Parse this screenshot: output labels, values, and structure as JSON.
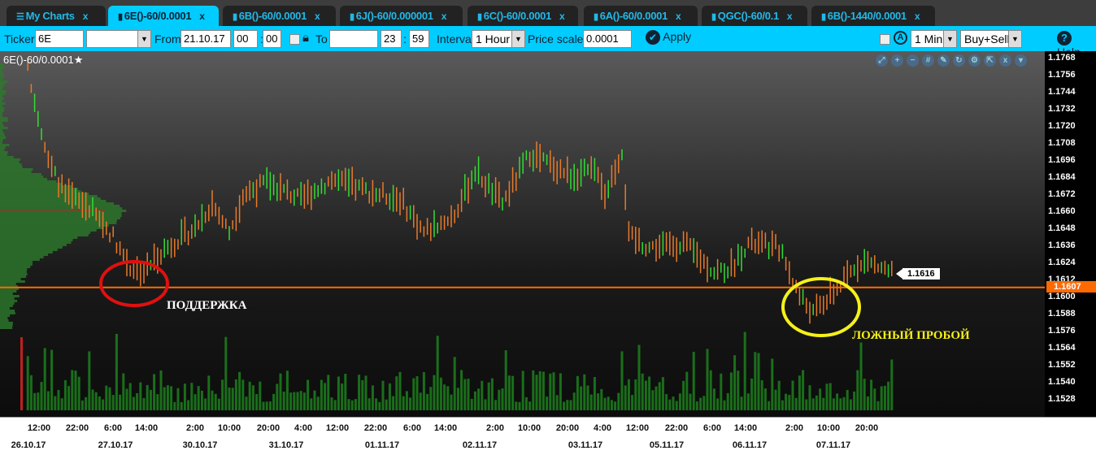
{
  "tabs": [
    {
      "label": "My Charts",
      "icon": "menu-icon",
      "active": false
    },
    {
      "label": "6E()-60/0.0001",
      "icon": "bar-chart-icon",
      "active": true
    },
    {
      "label": "6B()-60/0.0001",
      "icon": "bar-chart-icon",
      "active": false
    },
    {
      "label": "6J()-60/0.000001",
      "icon": "bar-chart-icon",
      "active": false
    },
    {
      "label": "6C()-60/0.0001",
      "icon": "bar-chart-icon",
      "active": false
    },
    {
      "label": "6A()-60/0.0001",
      "icon": "bar-chart-icon",
      "active": false
    },
    {
      "label": "QGC()-60/0.1",
      "icon": "bar-chart-icon",
      "active": false
    },
    {
      "label": "6B()-1440/0.0001",
      "icon": "bar-chart-icon",
      "active": false
    }
  ],
  "close_glyph": "x",
  "toolbar": {
    "ticker_label": "Ticker",
    "ticker": "6E",
    "from_label": "From",
    "from_date": "21.10.17",
    "from_h": "00",
    "from_m": "00",
    "to_label": "To",
    "to_date": "",
    "to_h": "23",
    "to_m": "59",
    "colon": ":",
    "interval_label": "Interval",
    "interval": "1 Hour",
    "price_scale_label": "Price scale",
    "price_scale": "0.0001",
    "apply": "Apply",
    "period": "1 Min",
    "side": "Buy+Sell",
    "help": "Help"
  },
  "chart": {
    "title": "6E()-60/0.0001",
    "last_price": "1.1616",
    "current_price": "1.1607",
    "annotation_support": "ПОДДЕРЖКА",
    "annotation_false_break": "ЛОЖНЫЙ ПРОБОЙ",
    "colors": {
      "up": "#e87a2a",
      "down": "#33dd33",
      "level": "#ff6a00",
      "volume": "#1f8f1f"
    },
    "toolbar_icons": [
      "zoom-fit-icon",
      "zoom-in-icon",
      "zoom-out-icon",
      "grid-icon",
      "pencil-icon",
      "refresh-icon",
      "gear-icon",
      "expand-icon",
      "close-icon",
      "chevron-down-icon"
    ]
  },
  "chart_data": {
    "type": "bar",
    "ylim": [
      1.1522,
      1.1774
    ],
    "price_ticks": [
      "1.1768",
      "1.1756",
      "1.1744",
      "1.1732",
      "1.1720",
      "1.1708",
      "1.1696",
      "1.1684",
      "1.1672",
      "1.1660",
      "1.1648",
      "1.1636",
      "1.1624",
      "1.1612",
      "1.1600",
      "1.1588",
      "1.1576",
      "1.1564",
      "1.1552",
      "1.1540",
      "1.1528"
    ],
    "time_ticks": [
      "12:00",
      "22:00",
      "6:00",
      "14:00",
      "2:00",
      "10:00",
      "20:00",
      "4:00",
      "12:00",
      "22:00",
      "6:00",
      "14:00",
      "2:00",
      "10:00",
      "20:00",
      "4:00",
      "12:00",
      "22:00",
      "6:00",
      "14:00",
      "2:00",
      "10:00",
      "20:00"
    ],
    "dates": [
      "26.10.17",
      "27.10.17",
      "30.10.17",
      "31.10.17",
      "01.11.17",
      "02.11.17",
      "03.11.17",
      "05.11.17",
      "06.11.17",
      "07.11.17"
    ],
    "path": [
      [
        1,
        1.1761
      ],
      [
        4,
        1.1729
      ],
      [
        7,
        1.1695
      ],
      [
        12,
        1.1672
      ],
      [
        19,
        1.1663
      ],
      [
        26,
        1.1643
      ],
      [
        31,
        1.1621
      ],
      [
        35,
        1.1618
      ],
      [
        40,
        1.1632
      ],
      [
        50,
        1.1649
      ],
      [
        55,
        1.1666
      ],
      [
        60,
        1.1646
      ],
      [
        64,
        1.1672
      ],
      [
        71,
        1.1681
      ],
      [
        81,
        1.1669
      ],
      [
        90,
        1.1683
      ],
      [
        100,
        1.1675
      ],
      [
        110,
        1.1669
      ],
      [
        117,
        1.1646
      ],
      [
        126,
        1.1658
      ],
      [
        132,
        1.1689
      ],
      [
        140,
        1.1666
      ],
      [
        148,
        1.1701
      ],
      [
        160,
        1.1686
      ],
      [
        168,
        1.1689
      ],
      [
        170,
        1.1672
      ],
      [
        175,
        1.1703
      ],
      [
        177,
        1.1643
      ],
      [
        183,
        1.1635
      ],
      [
        193,
        1.1638
      ],
      [
        202,
        1.1618
      ],
      [
        207,
        1.1621
      ],
      [
        212,
        1.1638
      ],
      [
        221,
        1.1635
      ],
      [
        227,
        1.1601
      ],
      [
        231,
        1.1589
      ],
      [
        236,
        1.1601
      ],
      [
        240,
        1.1612
      ],
      [
        245,
        1.1626
      ],
      [
        254,
        1.1618
      ]
    ],
    "level": 1.1607
  }
}
